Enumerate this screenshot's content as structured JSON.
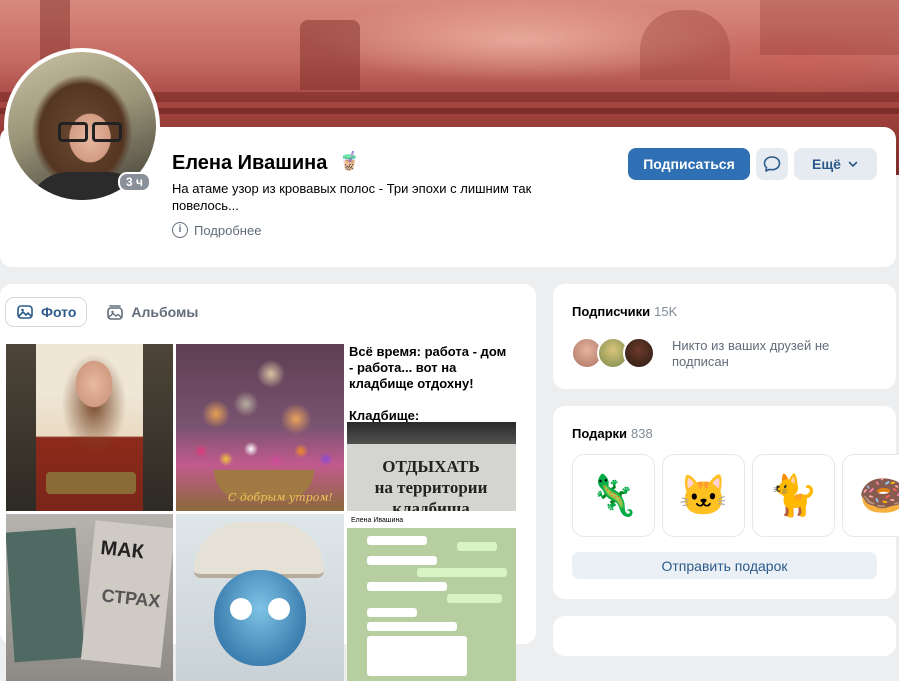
{
  "profile": {
    "name": "Елена Ивашина",
    "name_emoji": "🧋",
    "status": "На атаме узор из кровавых полос - Три эпохи с лишним так повелось...",
    "more_info_label": "Подробнее",
    "online_badge": "3 ч"
  },
  "actions": {
    "subscribe_label": "Подписаться",
    "more_label": "Ещё"
  },
  "photos": {
    "tabs": [
      {
        "label": "Фото",
        "active": true
      },
      {
        "label": "Альбомы",
        "active": false
      }
    ],
    "kittens_caption": "С добрым утром!",
    "meme_text": "Всё время: работа - дом - работа... вот на кладбище отдохну!\n\nКладбище:",
    "meme_sign": "ОТДЫХАТЬ\nна территории\nкладбища",
    "book_title_1": "МАК",
    "book_title_2": "СТРАХ",
    "chat_header": "Елена Ивашина"
  },
  "subscribers": {
    "title": "Подписчики",
    "count": "15K",
    "note": "Никто из ваших друзей не подписан"
  },
  "gifts": {
    "title": "Подарки",
    "count": "838",
    "items": [
      "🦎",
      "🐱",
      "🐈",
      "🍩"
    ],
    "send_label": "Отправить подарок"
  },
  "colors": {
    "accent": "#2f6fb3",
    "link": "#2c5a8a",
    "secondary_text": "#626d7a",
    "page_bg": "#edeef0"
  }
}
